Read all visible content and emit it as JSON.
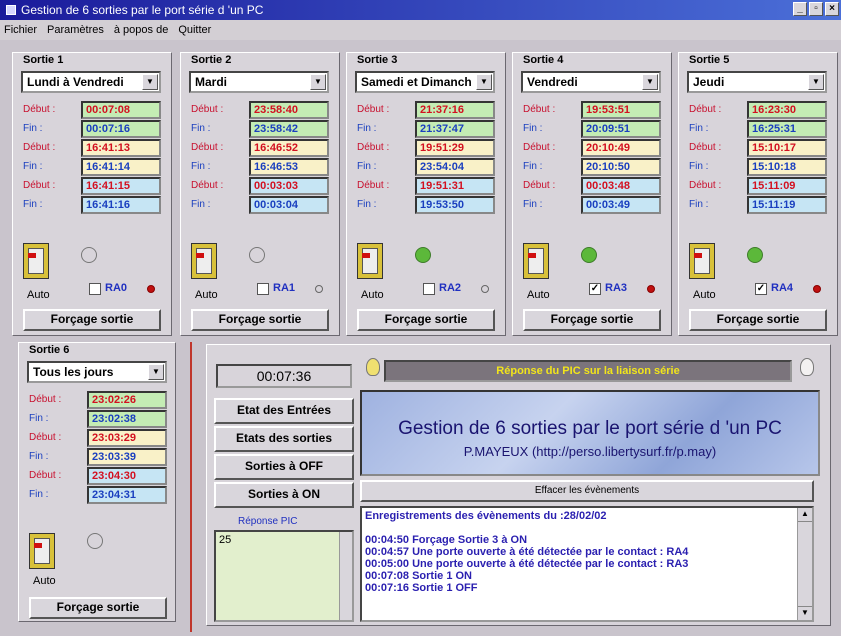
{
  "window": {
    "title": "Gestion de 6 sorties par le port série d 'un PC"
  },
  "menu": [
    "Fichier",
    "Paramètres",
    "à popos de",
    "Quitter"
  ],
  "labels": {
    "debut": "Début :",
    "fin": "Fin :",
    "auto": "Auto",
    "force": "Forçage sortie"
  },
  "sorties": [
    {
      "title": "Sortie 1",
      "day": "Lundi à Vendredi",
      "rows": [
        [
          "Début :",
          "00:07:08",
          "b1"
        ],
        [
          "Fin :",
          "00:07:16",
          "b1"
        ],
        [
          "Début :",
          "16:41:13",
          "b2"
        ],
        [
          "Fin :",
          "16:41:14",
          "b2"
        ],
        [
          "Début :",
          "16:41:15",
          "b3"
        ],
        [
          "Fin :",
          "16:41:16",
          "b3"
        ]
      ],
      "ra": "RA0",
      "checked": false,
      "lamp_on": false,
      "led_on": true
    },
    {
      "title": "Sortie 2",
      "day": "Mardi",
      "rows": [
        [
          "Début :",
          "23:58:40",
          "b1"
        ],
        [
          "Fin :",
          "23:58:42",
          "b1"
        ],
        [
          "Début :",
          "16:46:52",
          "b2"
        ],
        [
          "Fin :",
          "16:46:53",
          "b2"
        ],
        [
          "Début :",
          "00:03:03",
          "b3"
        ],
        [
          "Fin :",
          "00:03:04",
          "b3"
        ]
      ],
      "ra": "RA1",
      "checked": false,
      "lamp_on": false,
      "led_on": false
    },
    {
      "title": "Sortie 3",
      "day": "Samedi et Dimanch",
      "rows": [
        [
          "Début :",
          "21:37:16",
          "b1"
        ],
        [
          "Fin :",
          "21:37:47",
          "b1"
        ],
        [
          "Début :",
          "19:51:29",
          "b2"
        ],
        [
          "Fin :",
          "23:54:04",
          "b2"
        ],
        [
          "Début :",
          "19:51:31",
          "b3"
        ],
        [
          "Fin :",
          "19:53:50",
          "b3"
        ]
      ],
      "ra": "RA2",
      "checked": false,
      "lamp_on": true,
      "led_on": false
    },
    {
      "title": "Sortie 4",
      "day": "Vendredi",
      "rows": [
        [
          "Début :",
          "19:53:51",
          "b1"
        ],
        [
          "Fin :",
          "20:09:51",
          "b1"
        ],
        [
          "Début :",
          "20:10:49",
          "b2"
        ],
        [
          "Fin :",
          "20:10:50",
          "b2"
        ],
        [
          "Début :",
          "00:03:48",
          "b3"
        ],
        [
          "Fin :",
          "00:03:49",
          "b3"
        ]
      ],
      "ra": "RA3",
      "checked": true,
      "lamp_on": true,
      "led_on": true
    },
    {
      "title": "Sortie 5",
      "day": "Jeudi",
      "rows": [
        [
          "Début :",
          "16:23:30",
          "b1"
        ],
        [
          "Fin :",
          "16:25:31",
          "b1"
        ],
        [
          "Début :",
          "15:10:17",
          "b2"
        ],
        [
          "Fin :",
          "15:10:18",
          "b2"
        ],
        [
          "Début :",
          "15:11:09",
          "b3"
        ],
        [
          "Fin :",
          "15:11:19",
          "b3"
        ]
      ],
      "ra": "RA4",
      "checked": true,
      "lamp_on": true,
      "led_on": true
    },
    {
      "title": "Sortie 6",
      "day": "Tous les jours",
      "rows": [
        [
          "Début :",
          "23:02:26",
          "b1"
        ],
        [
          "Fin :",
          "23:02:38",
          "b1"
        ],
        [
          "Début :",
          "23:03:29",
          "b2"
        ],
        [
          "Fin :",
          "23:03:39",
          "b2"
        ],
        [
          "Début :",
          "23:04:30",
          "b3"
        ],
        [
          "Fin :",
          "23:04:31",
          "b3"
        ]
      ],
      "lamp_on": false
    }
  ],
  "clock": "00:07:36",
  "pic_status": "Réponse du PIC sur la liaison série",
  "buttons": {
    "inputs": "Etat des Entrées",
    "outputs": "Etats des sorties",
    "off": "Sorties à OFF",
    "on": "Sorties à ON",
    "clear": "Effacer les évènements"
  },
  "banner": {
    "title": "Gestion de 6 sorties par le port série d 'un PC",
    "subtitle": "P.MAYEUX (http://perso.libertysurf.fr/p.may)"
  },
  "pic_label": "Réponse PIC",
  "pic_value": "25",
  "log": [
    "Enregistrements des évènements du :28/02/02",
    "",
    "00:04:50 Forçage Sortie 3 à ON",
    "00:04:57 Une porte ouverte à été détectée par le contact  : RA4",
    "00:05:00 Une porte ouverte à été détectée par le contact  : RA3",
    "00:07:08 Sortie 1 ON",
    "00:07:16 Sortie 1 OFF"
  ],
  "colors": {
    "title_bar": "#1b1b9b",
    "status_bar": "#7b747c",
    "status_text": "#f2e51a",
    "banner_text": "#1a1470",
    "log_text": "#2a1fb0"
  }
}
